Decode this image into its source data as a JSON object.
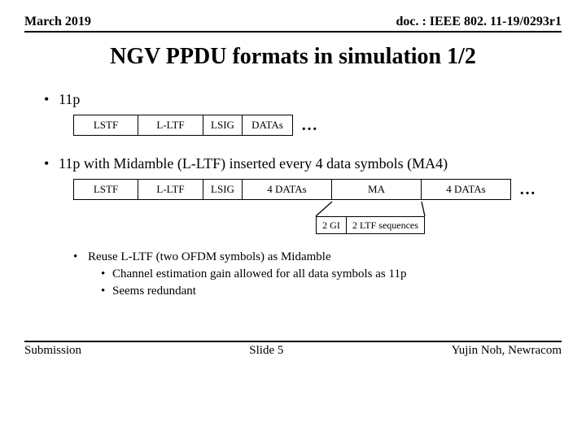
{
  "header": {
    "left": "March 2019",
    "right": "doc. : IEEE 802. 11-19/0293r1"
  },
  "title": "NGV PPDU formats in simulation 1/2",
  "bullets": {
    "b1": "11p",
    "b2": "11p with Midamble (L-LTF) inserted every 4 data symbols (MA4)"
  },
  "row1": {
    "lstf": "LSTF",
    "lltf": "L-LTF",
    "lsig": "LSIG",
    "datas": "DATAs",
    "ell": "…"
  },
  "row2": {
    "lstf": "LSTF",
    "lltf": "L-LTF",
    "lsig": "LSIG",
    "fourdatas_a": "4 DATAs",
    "ma": "MA",
    "fourdatas_b": "4 DATAs",
    "ell": "…"
  },
  "subrow": {
    "twogi": "2 GI",
    "twoltf": "2 LTF sequences"
  },
  "notes": {
    "lead": "Reuse L-LTF (two OFDM symbols) as Midamble",
    "i1": "Channel estimation gain allowed for all data symbols as 11p",
    "i2": "Seems redundant"
  },
  "footer": {
    "left": "Submission",
    "center": "Slide 5",
    "right": "Yujin Noh, Newracom"
  }
}
